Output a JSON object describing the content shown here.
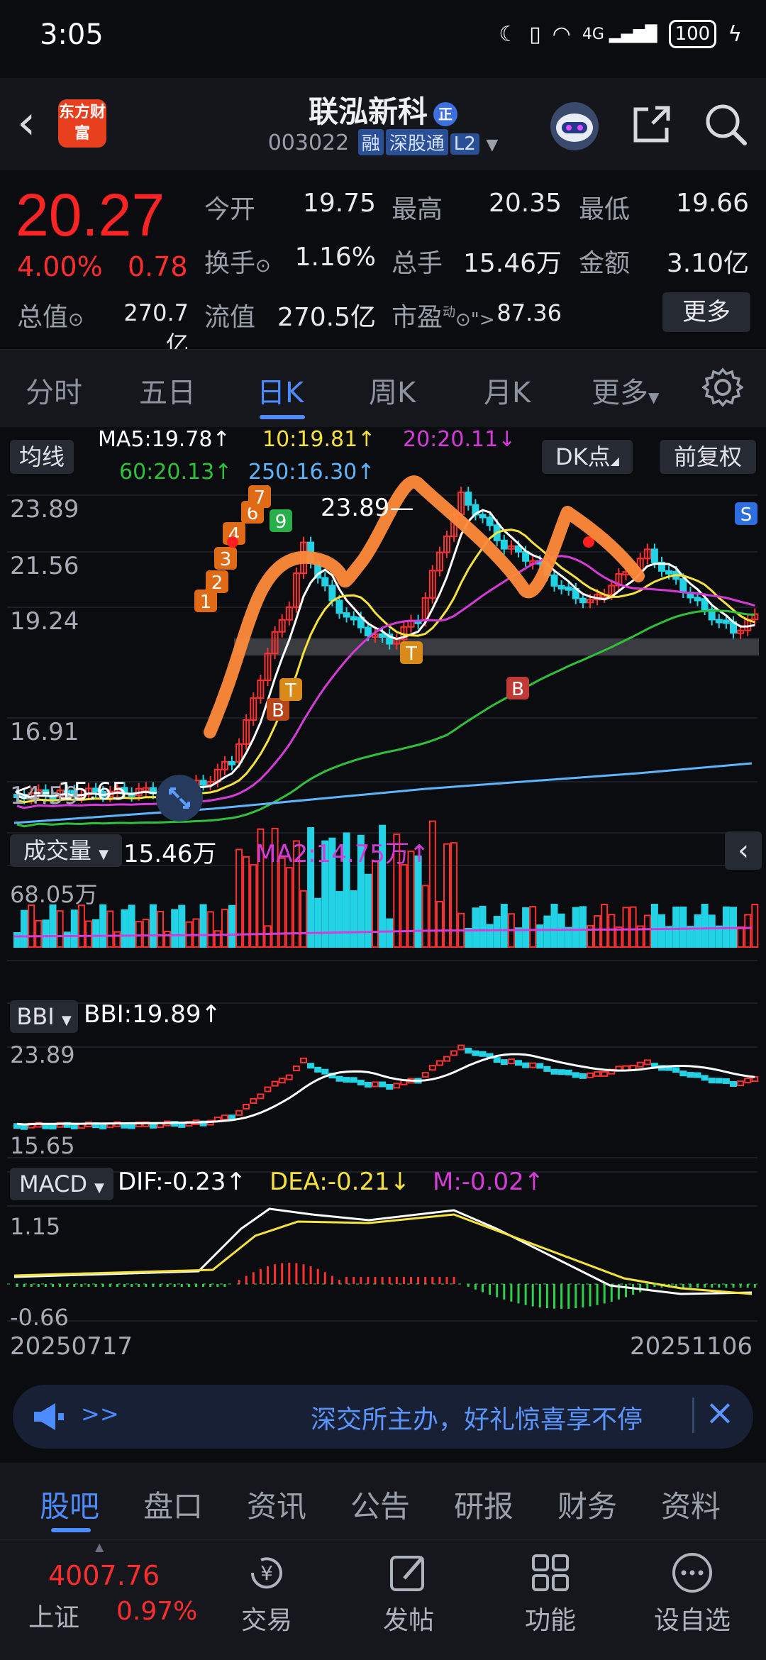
{
  "status": {
    "time": "3:05",
    "battery": "100"
  },
  "header": {
    "title": "联泓新科",
    "badge": "正",
    "code": "003022",
    "tags": [
      "融",
      "深股通",
      "L2"
    ],
    "logo_text": "东方财富"
  },
  "quote": {
    "price": "20.27",
    "pct": "4.00%",
    "change": "0.78",
    "open_label": "今开",
    "open": "19.75",
    "high_label": "最高",
    "high": "20.35",
    "low_label": "最低",
    "low": "19.66",
    "turnover_label": "换手",
    "turnover": "1.16%",
    "volume_label": "总手",
    "volume": "15.46万",
    "amount_label": "金额",
    "amount": "3.10亿",
    "mktcap_label": "总值",
    "mktcap": "270.7亿",
    "float_label": "流值",
    "float": "270.5亿",
    "pe_label": "市盈",
    "pe_sup": "动",
    "pe": "87.36",
    "more_label": "更多"
  },
  "tabs": [
    "分时",
    "五日",
    "日K",
    "周K",
    "月K",
    "更多"
  ],
  "chart": {
    "ma_button": "均线",
    "ma5": "MA5:19.78↑",
    "ma10": "10:19.81↑",
    "ma20": "20:20.11↓",
    "ma60": "60:20.13↑",
    "ma250": "250:16.30↑",
    "dk_button": "DK点",
    "fq_button": "前复权",
    "price_axis": [
      "23.89",
      "21.56",
      "19.24",
      "16.91",
      "14.59"
    ],
    "high_mark": "23.89",
    "low_mark": "<-- 15.65",
    "vol_button": "成交量",
    "vol_value": "15.46万",
    "vol_ma2": "MA2:14.75万↑",
    "vol_axis": "68.05万",
    "bbi_button": "BBI",
    "bbi_value": "BBI:19.89↑",
    "bbi_axis_top": "23.89",
    "bbi_axis_bottom": "15.65",
    "macd_button": "MACD",
    "dif": "DIF:-0.23↑",
    "dea": "DEA:-0.21↓",
    "m": "M:-0.02↑",
    "macd_axis_top": "1.15",
    "macd_axis_bottom": "-0.66",
    "date_start": "20250717",
    "date_end": "20251106"
  },
  "banner": {
    "arrows": ">>",
    "text": "深交所主办，好礼惊喜享不停"
  },
  "bottom_tabs": [
    "股吧",
    "盘口",
    "资讯",
    "公告",
    "研报",
    "财务",
    "资料"
  ],
  "nav": {
    "index_value": "4007.76",
    "index_name": "上证",
    "index_pct": "0.97%",
    "items": [
      "交易",
      "发帖",
      "功能",
      "设自选"
    ]
  }
}
